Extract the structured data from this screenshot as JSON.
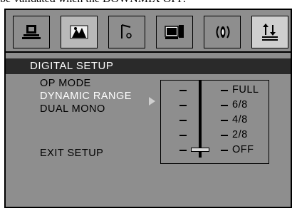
{
  "caption": "be validated when the DOWNMIX OFF.",
  "tabs": [
    {
      "icon": "general-setup-icon"
    },
    {
      "icon": "video-setup-icon"
    },
    {
      "icon": "audio-setup-icon"
    },
    {
      "icon": "preference-setup-icon"
    },
    {
      "icon": "speaker-setup-icon"
    },
    {
      "icon": "digital-setup-icon"
    }
  ],
  "header": {
    "title": "DIGITAL SETUP"
  },
  "menu": {
    "items": [
      {
        "label": "OP MODE"
      },
      {
        "label": "DYNAMIC RANGE"
      },
      {
        "label": "DUAL MONO"
      },
      {
        "label": "EXIT SETUP"
      }
    ],
    "selected_index": 1
  },
  "dynamic_range": {
    "levels": [
      "FULL",
      "6/8",
      "4/8",
      "2/8",
      "OFF"
    ],
    "selected": "OFF"
  },
  "colors": {
    "background": "#8e8e8e",
    "header": "#2a2a2a",
    "highlight_text": "#ffffff"
  }
}
